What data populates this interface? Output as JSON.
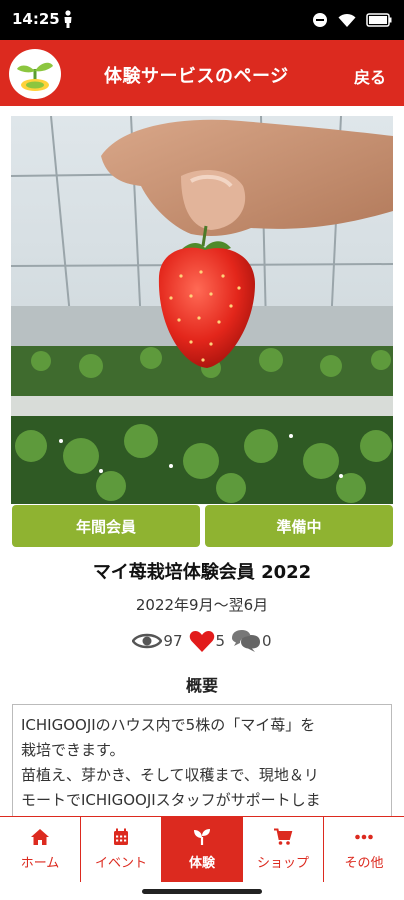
{
  "status_bar": {
    "time": "14:25"
  },
  "header": {
    "title": "体験サービスのページ",
    "back_label": "戻る",
    "brand_color": "#dc2a1f"
  },
  "detail": {
    "tags": [
      "年間会員",
      "準備中"
    ],
    "title": "マイ苺栽培体験会員 2022",
    "period": "2022年9月～翌6月",
    "stats": {
      "views": "97",
      "likes": "5",
      "comments": "0"
    },
    "section_heading": "概要",
    "description_lines": [
      "ICHIGOOJIのハウス内で5株の「マイ苺」を",
      "栽培できます。",
      "苗植え、芽かき、そして収穫まで、現地＆リ",
      "モートでICHIGOOJIスタッフがサポートしま"
    ],
    "tag_color": "#8fb331"
  },
  "tabbar": {
    "items": [
      {
        "label": "ホーム",
        "icon": "home-icon",
        "active": false
      },
      {
        "label": "イベント",
        "icon": "calendar-icon",
        "active": false
      },
      {
        "label": "体験",
        "icon": "sprout-icon",
        "active": true
      },
      {
        "label": "ショップ",
        "icon": "cart-icon",
        "active": false
      },
      {
        "label": "その他",
        "icon": "more-icon",
        "active": false
      }
    ]
  }
}
